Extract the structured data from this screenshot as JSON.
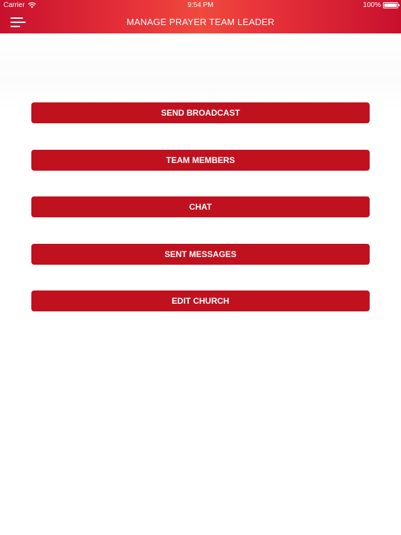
{
  "status_bar": {
    "carrier": "Carrier",
    "time": "9:54 PM",
    "battery": "100%",
    "wifi_icon": "wifi-icon",
    "battery_icon": "battery-icon"
  },
  "header": {
    "title": "MANAGE PRAYER TEAM LEADER",
    "menu_icon": "hamburger-menu-icon",
    "gradient_colors": [
      "#c8102e",
      "#ef4a3e"
    ]
  },
  "actions": [
    {
      "label": "SEND BROADCAST"
    },
    {
      "label": "TEAM MEMBERS"
    },
    {
      "label": "CHAT"
    },
    {
      "label": "SENT MESSAGES"
    },
    {
      "label": "EDIT CHURCH"
    }
  ],
  "colors": {
    "button_background": "#c0111f",
    "button_text": "#ffffff",
    "page_background": "#ffffff"
  }
}
